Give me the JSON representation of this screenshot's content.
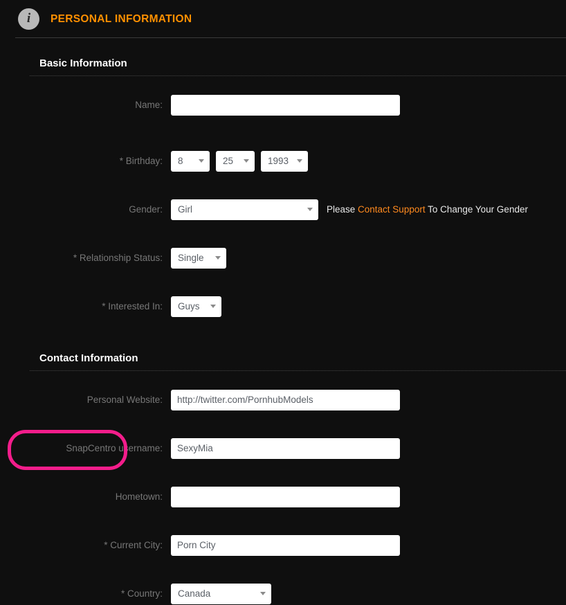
{
  "header": {
    "icon": "info-circle-icon",
    "title": "PERSONAL INFORMATION"
  },
  "sections": [
    {
      "key": "basic",
      "title": "Basic Information"
    },
    {
      "key": "contact",
      "title": "Contact Information"
    }
  ],
  "basic": {
    "name": {
      "label": "Name:",
      "value": "",
      "placeholder": ""
    },
    "birthday": {
      "label": "* Birthday:",
      "month": "8",
      "day": "25",
      "year": "1993"
    },
    "gender": {
      "label": "Gender:",
      "value": "Girl",
      "note_before": "Please ",
      "note_link": "Contact Support",
      "note_after": " To Change Your Gender"
    },
    "relationship": {
      "label": "* Relationship Status:",
      "value": "Single"
    },
    "interested_in": {
      "label": "* Interested In:",
      "value": "Guys"
    }
  },
  "contact": {
    "website": {
      "label": "Personal Website:",
      "value": "http://twitter.com/PornhubModels",
      "placeholder": ""
    },
    "snapcentro": {
      "label": "SnapCentro username:",
      "value": "SexyMia",
      "placeholder": "",
      "highlighted": true
    },
    "hometown": {
      "label": "Hometown:",
      "value": "",
      "placeholder": ""
    },
    "current_city": {
      "label": "* Current City:",
      "value": "Porn City",
      "placeholder": ""
    },
    "country": {
      "label": "* Country:",
      "value": "Canada"
    }
  },
  "colors": {
    "page_background": "#0f0f0f",
    "accent_orange": "#ff9000",
    "link_orange": "#ff8a1e",
    "label_gray": "#777777",
    "input_background": "#ffffff",
    "input_text": "#5a5f66",
    "annotation_pink": "#f31d8b",
    "divider": "#3a3a3a"
  }
}
